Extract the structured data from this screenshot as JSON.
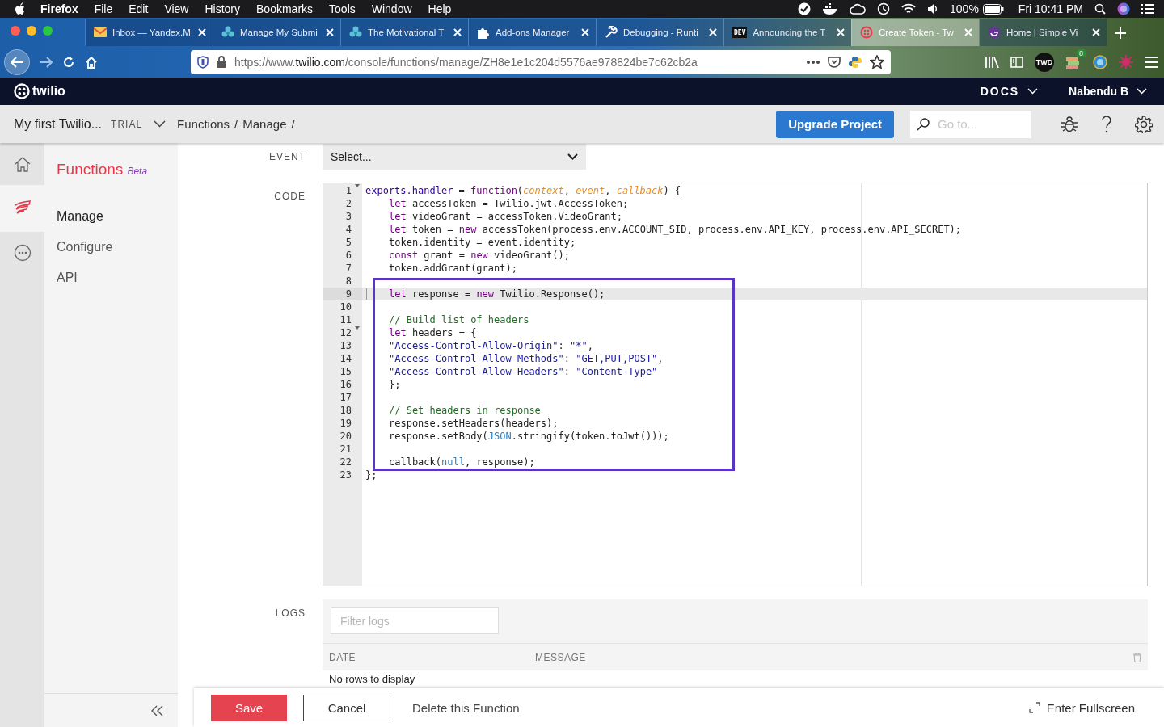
{
  "menu_bar": {
    "app": "Firefox",
    "menus": [
      "File",
      "Edit",
      "View",
      "History",
      "Bookmarks",
      "Tools",
      "Window",
      "Help"
    ],
    "battery": "100%",
    "clock": "Fri 10:41 PM"
  },
  "tabs": [
    {
      "title": "Inbox — Yandex.M",
      "selected": false
    },
    {
      "title": "Manage My Submi",
      "selected": false
    },
    {
      "title": "The Motivational T",
      "selected": false
    },
    {
      "title": "Add-ons Manager",
      "selected": false
    },
    {
      "title": "Debugging - Runti",
      "selected": false
    },
    {
      "title": "Announcing the T",
      "favicon_text": "DEV",
      "selected": false
    },
    {
      "title": "Create Token - Tw",
      "selected": true
    },
    {
      "title": "Home | Simple Vi",
      "selected": false
    }
  ],
  "address_bar": {
    "url_scheme": "https://www.",
    "url_host": "twilio.com",
    "url_path": "/console/functions/manage/ZH8e1e1c204d5576ae978824be7c62cb2a"
  },
  "toolbar": {
    "extension_label": "TWD",
    "extension_badge": "8"
  },
  "topbar": {
    "logo": "twilio",
    "docs": "DOCS",
    "user": "Nabendu B"
  },
  "subheader": {
    "project": "My first Twilio...",
    "plan": "TRIAL",
    "breadcrumbs": [
      "Functions",
      "Manage"
    ],
    "separator": "/",
    "upgrade_button": "Upgrade Project",
    "search": {
      "placeholder": "Go to..."
    }
  },
  "rail": [
    {
      "selected": false
    },
    {
      "selected": true
    },
    {
      "selected": false
    }
  ],
  "nav": {
    "title": "Functions",
    "badge": "Beta",
    "items": [
      {
        "label": "Manage",
        "selected": true
      },
      {
        "label": "Configure",
        "selected": false
      },
      {
        "label": "API",
        "selected": false
      }
    ]
  },
  "event": {
    "label": "EVENT",
    "value": "Select..."
  },
  "code": {
    "label": "CODE",
    "blocks": [
      {
        "boxed": false,
        "lines": [
          {
            "number": "1",
            "fold": true,
            "active": false,
            "indented": false,
            "tokens": [
              {
                "kind": "def",
                "text": "exports.handler"
              },
              {
                "kind": "plain",
                "text": " = "
              },
              {
                "kind": "keyword",
                "text": "function"
              },
              {
                "kind": "plain",
                "text": "("
              },
              {
                "kind": "param",
                "text": "context"
              },
              {
                "kind": "plain",
                "text": ", "
              },
              {
                "kind": "param",
                "text": "event"
              },
              {
                "kind": "plain",
                "text": ", "
              },
              {
                "kind": "param",
                "text": "callback"
              },
              {
                "kind": "plain",
                "text": ") {"
              }
            ]
          },
          {
            "number": "2",
            "fold": false,
            "active": false,
            "indented": true,
            "tokens": [
              {
                "kind": "keyword",
                "text": "let"
              },
              {
                "kind": "plain",
                "text": " accessToken = Twilio.jwt.AccessToken;"
              }
            ]
          },
          {
            "number": "3",
            "fold": false,
            "active": false,
            "indented": true,
            "tokens": [
              {
                "kind": "keyword",
                "text": "let"
              },
              {
                "kind": "plain",
                "text": " videoGrant = accessToken.VideoGrant;"
              }
            ]
          },
          {
            "number": "4",
            "fold": false,
            "active": false,
            "indented": true,
            "tokens": [
              {
                "kind": "keyword",
                "text": "let"
              },
              {
                "kind": "plain",
                "text": " token = "
              },
              {
                "kind": "keyword",
                "text": "new"
              },
              {
                "kind": "plain",
                "text": " accessToken(process.env.ACCOUNT_SID, process.env.API_KEY, process.env.API_SECRET);"
              }
            ]
          },
          {
            "number": "5",
            "fold": false,
            "active": false,
            "indented": true,
            "tokens": [
              {
                "kind": "plain",
                "text": "token.identity = event.identity;"
              }
            ]
          },
          {
            "number": "6",
            "fold": false,
            "active": false,
            "indented": true,
            "tokens": [
              {
                "kind": "keyword",
                "text": "const"
              },
              {
                "kind": "plain",
                "text": " grant = "
              },
              {
                "kind": "keyword",
                "text": "new"
              },
              {
                "kind": "plain",
                "text": " videoGrant();"
              }
            ]
          },
          {
            "number": "7",
            "fold": false,
            "active": false,
            "indented": true,
            "tokens": [
              {
                "kind": "plain",
                "text": "token.addGrant(grant);"
              }
            ]
          },
          {
            "number": "8",
            "fold": false,
            "active": false
          }
        ]
      },
      {
        "boxed": true,
        "lines": [
          {
            "number": "9",
            "fold": false,
            "active": true,
            "indented": true,
            "tokens": [
              {
                "kind": "keyword",
                "text": "let"
              },
              {
                "kind": "plain",
                "text": " response = "
              },
              {
                "kind": "keyword",
                "text": "new"
              },
              {
                "kind": "plain",
                "text": " Twilio.Response();"
              }
            ]
          },
          {
            "number": "10",
            "fold": false,
            "active": false
          },
          {
            "number": "11",
            "fold": false,
            "active": false,
            "indented": true,
            "tokens": [
              {
                "kind": "comment",
                "text": "// Build list of headers"
              }
            ]
          },
          {
            "number": "12",
            "fold": true,
            "active": false,
            "indented": true,
            "tokens": [
              {
                "kind": "keyword",
                "text": "let"
              },
              {
                "kind": "plain",
                "text": " headers = {"
              }
            ]
          },
          {
            "number": "13",
            "fold": false,
            "active": false,
            "indented": true,
            "tokens": [
              {
                "kind": "string",
                "text": "\"Access-Control-Allow-Origin\""
              },
              {
                "kind": "plain",
                "text": ": "
              },
              {
                "kind": "string",
                "text": "\"*\""
              },
              {
                "kind": "plain",
                "text": ","
              }
            ]
          },
          {
            "number": "14",
            "fold": false,
            "active": false,
            "indented": true,
            "tokens": [
              {
                "kind": "string",
                "text": "\"Access-Control-Allow-Methods\""
              },
              {
                "kind": "plain",
                "text": ": "
              },
              {
                "kind": "string",
                "text": "\"GET,PUT,POST\""
              },
              {
                "kind": "plain",
                "text": ","
              }
            ]
          },
          {
            "number": "15",
            "fold": false,
            "active": false,
            "indented": true,
            "tokens": [
              {
                "kind": "string",
                "text": "\"Access-Control-Allow-Headers\""
              },
              {
                "kind": "plain",
                "text": ": "
              },
              {
                "kind": "string",
                "text": "\"Content-Type\""
              }
            ]
          },
          {
            "number": "16",
            "fold": false,
            "active": false,
            "indented": true,
            "tokens": [
              {
                "kind": "plain",
                "text": "};"
              }
            ]
          },
          {
            "number": "17",
            "fold": false,
            "active": false
          },
          {
            "number": "18",
            "fold": false,
            "active": false,
            "indented": true,
            "tokens": [
              {
                "kind": "comment",
                "text": "// Set headers in response"
              }
            ]
          },
          {
            "number": "19",
            "fold": false,
            "active": false,
            "indented": true,
            "tokens": [
              {
                "kind": "plain",
                "text": "response.setHeaders(headers);"
              }
            ]
          },
          {
            "number": "20",
            "fold": false,
            "active": false,
            "indented": true,
            "tokens": [
              {
                "kind": "plain",
                "text": "response.setBody("
              },
              {
                "kind": "builtin",
                "text": "JSON"
              },
              {
                "kind": "plain",
                "text": ".stringify(token.toJwt()));"
              }
            ]
          },
          {
            "number": "21",
            "fold": false,
            "active": false
          },
          {
            "number": "22",
            "fold": false,
            "active": false,
            "indented": true,
            "tokens": [
              {
                "kind": "plain",
                "text": "callback("
              },
              {
                "kind": "builtin",
                "text": "null"
              },
              {
                "kind": "plain",
                "text": ", response);"
              }
            ]
          }
        ]
      },
      {
        "boxed": false,
        "lines": [
          {
            "number": "23",
            "fold": false,
            "active": false,
            "indented": false,
            "tokens": [
              {
                "kind": "plain",
                "text": "};"
              }
            ]
          }
        ]
      }
    ]
  },
  "logs": {
    "label": "LOGS",
    "filter": {
      "placeholder": "Filter logs"
    },
    "columns": [
      "DATE",
      "MESSAGE"
    ],
    "empty": "No rows to display"
  },
  "footer": {
    "save": "Save",
    "cancel": "Cancel",
    "delete": "Delete this Function",
    "fullscreen": "Enter Fullscreen"
  }
}
